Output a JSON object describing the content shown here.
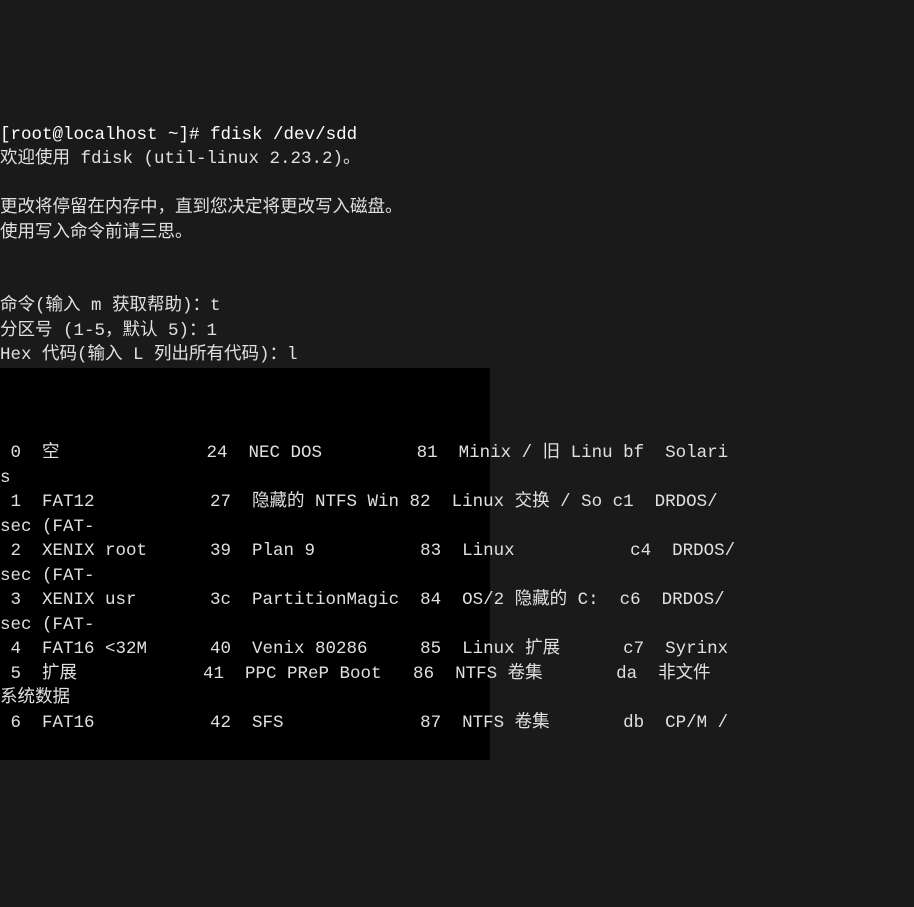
{
  "prompt": "[root@localhost ~]# ",
  "command": "fdisk /dev/sdd",
  "welcome": "欢迎使用 fdisk (util-linux 2.23.2)。",
  "blank": "",
  "warn1": "更改将停留在内存中，直到您决定将更改写入磁盘。",
  "warn2": "使用写入命令前请三思。",
  "cmd_prompt": "命令(输入 m 获取帮助)：t",
  "part_prompt": "分区号 (1-5，默认 5)：1",
  "hex_prompt": "Hex 代码(输入 L 列出所有代码)：l",
  "rows": [
    {
      "c1": " 0",
      "n1": "空",
      "c2": "24",
      "n2": "NEC DOS",
      "c3": "81",
      "n3": "Minix / 旧 Linu",
      "c4": "bf",
      "n4": "Solari",
      "wrap": "s"
    },
    {
      "c1": " 1",
      "n1": "FAT12",
      "c2": "27",
      "n2": "隐藏的 NTFS Win",
      "c3": "82",
      "n3": "Linux 交换 / So",
      "c4": "c1",
      "n4": "DRDOS/",
      "wrap": "sec (FAT-"
    },
    {
      "c1": " 2",
      "n1": "XENIX root",
      "c2": "39",
      "n2": "Plan 9",
      "c3": "83",
      "n3": "Linux",
      "c4": "c4",
      "n4": "DRDOS/",
      "wrap": "sec (FAT-"
    },
    {
      "c1": " 3",
      "n1": "XENIX usr",
      "c2": "3c",
      "n2": "PartitionMagic",
      "c3": "84",
      "n3": "OS/2 隐藏的 C:",
      "c4": "c6",
      "n4": "DRDOS/",
      "wrap": "sec (FAT-"
    },
    {
      "c1": " 4",
      "n1": "FAT16 <32M",
      "c2": "40",
      "n2": "Venix 80286",
      "c3": "85",
      "n3": "Linux 扩展",
      "c4": "c7",
      "n4": "Syrinx",
      "wrap": ""
    },
    {
      "c1": " 5",
      "n1": "扩展",
      "c2": "41",
      "n2": "PPC PReP Boot",
      "c3": "86",
      "n3": "NTFS 卷集",
      "c4": "da",
      "n4": "非文件",
      "wrap": "系统数据"
    },
    {
      "c1": " 6",
      "n1": "FAT16",
      "c2": "42",
      "n2": "SFS",
      "c3": "87",
      "n3": "NTFS 卷集",
      "c4": "db",
      "n4": "CP/M /",
      "wrap": ""
    }
  ]
}
